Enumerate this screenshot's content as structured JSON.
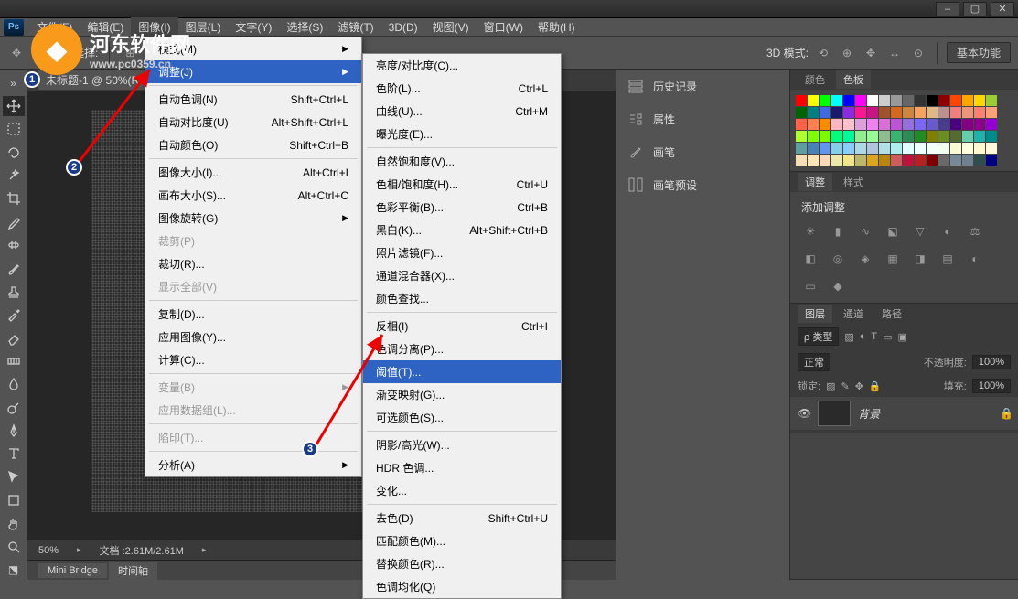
{
  "menubar": {
    "items": [
      "文件(F)",
      "编辑(E)",
      "图像(I)",
      "图层(L)",
      "文字(Y)",
      "选择(S)",
      "滤镜(T)",
      "3D(D)",
      "视图(V)",
      "窗口(W)",
      "帮助(H)"
    ]
  },
  "optionsbar": {
    "auto_select_label": "自动选择:",
    "mode_3d_label": "3D 模式:",
    "basic_btn": "基本功能"
  },
  "doc": {
    "tab_title": "未标题-1 @ 50%(R",
    "zoom": "50%",
    "filesize": "文档 :2.61M/2.61M"
  },
  "bottom_tabs": [
    "Mini Bridge",
    "时间轴"
  ],
  "image_menu": {
    "items": [
      {
        "label": "模式(M)",
        "sub": true
      },
      {
        "label": "调整(J)",
        "sub": true,
        "hl": true
      },
      {
        "sep": true
      },
      {
        "label": "自动色调(N)",
        "shortcut": "Shift+Ctrl+L"
      },
      {
        "label": "自动对比度(U)",
        "shortcut": "Alt+Shift+Ctrl+L"
      },
      {
        "label": "自动颜色(O)",
        "shortcut": "Shift+Ctrl+B"
      },
      {
        "sep": true
      },
      {
        "label": "图像大小(I)...",
        "shortcut": "Alt+Ctrl+I"
      },
      {
        "label": "画布大小(S)...",
        "shortcut": "Alt+Ctrl+C"
      },
      {
        "label": "图像旋转(G)",
        "sub": true
      },
      {
        "label": "裁剪(P)",
        "disabled": true
      },
      {
        "label": "裁切(R)..."
      },
      {
        "label": "显示全部(V)",
        "disabled": true
      },
      {
        "sep": true
      },
      {
        "label": "复制(D)..."
      },
      {
        "label": "应用图像(Y)..."
      },
      {
        "label": "计算(C)..."
      },
      {
        "sep": true
      },
      {
        "label": "变量(B)",
        "sub": true,
        "disabled": true
      },
      {
        "label": "应用数据组(L)...",
        "disabled": true
      },
      {
        "sep": true
      },
      {
        "label": "陷印(T)...",
        "disabled": true
      },
      {
        "sep": true
      },
      {
        "label": "分析(A)",
        "sub": true
      }
    ]
  },
  "adjust_submenu": {
    "items": [
      {
        "label": "亮度/对比度(C)..."
      },
      {
        "label": "色阶(L)...",
        "shortcut": "Ctrl+L"
      },
      {
        "label": "曲线(U)...",
        "shortcut": "Ctrl+M"
      },
      {
        "label": "曝光度(E)..."
      },
      {
        "sep": true
      },
      {
        "label": "自然饱和度(V)..."
      },
      {
        "label": "色相/饱和度(H)...",
        "shortcut": "Ctrl+U"
      },
      {
        "label": "色彩平衡(B)...",
        "shortcut": "Ctrl+B"
      },
      {
        "label": "黑白(K)...",
        "shortcut": "Alt+Shift+Ctrl+B"
      },
      {
        "label": "照片滤镜(F)..."
      },
      {
        "label": "通道混合器(X)..."
      },
      {
        "label": "颜色查找..."
      },
      {
        "sep": true
      },
      {
        "label": "反相(I)",
        "shortcut": "Ctrl+I"
      },
      {
        "label": "色调分离(P)..."
      },
      {
        "label": "阈值(T)...",
        "hl": true
      },
      {
        "label": "渐变映射(G)..."
      },
      {
        "label": "可选颜色(S)..."
      },
      {
        "sep": true
      },
      {
        "label": "阴影/高光(W)..."
      },
      {
        "label": "HDR 色调..."
      },
      {
        "label": "变化..."
      },
      {
        "sep": true
      },
      {
        "label": "去色(D)",
        "shortcut": "Shift+Ctrl+U"
      },
      {
        "label": "匹配颜色(M)..."
      },
      {
        "label": "替换颜色(R)..."
      },
      {
        "label": "色调均化(Q)"
      }
    ]
  },
  "right_col1": {
    "items": [
      "历史记录",
      "属性",
      "画笔",
      "画笔预设"
    ]
  },
  "panels": {
    "color_tab": "颜色",
    "swatch_tab": "色板",
    "adjust_tab": "调整",
    "style_tab": "样式",
    "adjust_title": "添加调整",
    "layers_tab": "图层",
    "channels_tab": "通道",
    "paths_tab": "路径",
    "kind_label": "ρ 类型",
    "blend_mode": "正常",
    "opacity_label": "不透明度:",
    "opacity_val": "100%",
    "lock_label": "锁定:",
    "fill_label": "填充:",
    "fill_val": "100%",
    "layer_name": "背景"
  },
  "watermark": {
    "title": "河东软件网",
    "url": "www.pc0359.cn"
  }
}
